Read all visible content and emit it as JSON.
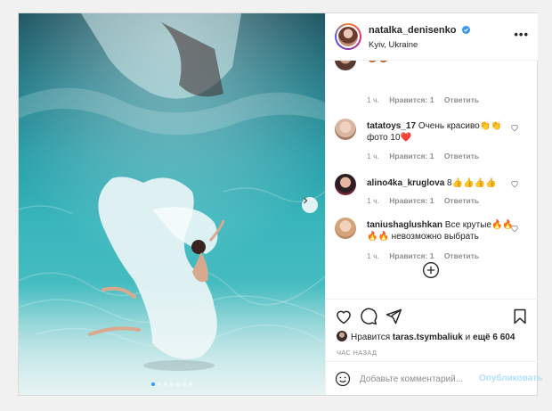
{
  "post": {
    "username": "natalka_denisenko",
    "location": "Kyiv, Ukraine",
    "more_label": "•••",
    "image_count": 7,
    "active_image": 1,
    "colors": {
      "verified": "#3897f0",
      "link_disabled": "#b2dffc",
      "heart": "#ed4956",
      "muted": "#8e8e8e"
    }
  },
  "comments": [
    {
      "user": "",
      "text": "🍪🍪",
      "time": "1 ч.",
      "likes": "Нравится: 1",
      "reply": "Ответить"
    },
    {
      "user": "tatatoys_17",
      "text": "Очень красиво👏👏 фото 10❤️",
      "time": "1 ч.",
      "likes": "Нравится: 1",
      "reply": "Ответить"
    },
    {
      "user": "alino4ka_kruglova",
      "text": "8👍👍👍👍",
      "time": "1 ч.",
      "likes": "Нравится: 1",
      "reply": "Ответить"
    },
    {
      "user": "taniushaglushkan",
      "text": "Все крутые🔥🔥🔥🔥 невозможно выбрать",
      "time": "1 ч.",
      "likes": "Нравится: 1",
      "reply": "Ответить"
    }
  ],
  "icons": {
    "like": "heart-icon",
    "comment": "comment-icon",
    "share": "paper-plane-icon",
    "save": "bookmark-icon",
    "load_more": "plus-circle-icon",
    "emoji": "smiley-icon",
    "next": "chevron-right-icon",
    "verified": "verified-badge-icon"
  },
  "likes": {
    "prefix": "Нравится",
    "user": "taras.tsymbaliuk",
    "and": "и",
    "others": "ещё 6 604"
  },
  "time_ago": "ЧАС НАЗАД",
  "comment_box": {
    "placeholder": "Добавьте комментарий...",
    "publish_label": "Опубликовать"
  }
}
